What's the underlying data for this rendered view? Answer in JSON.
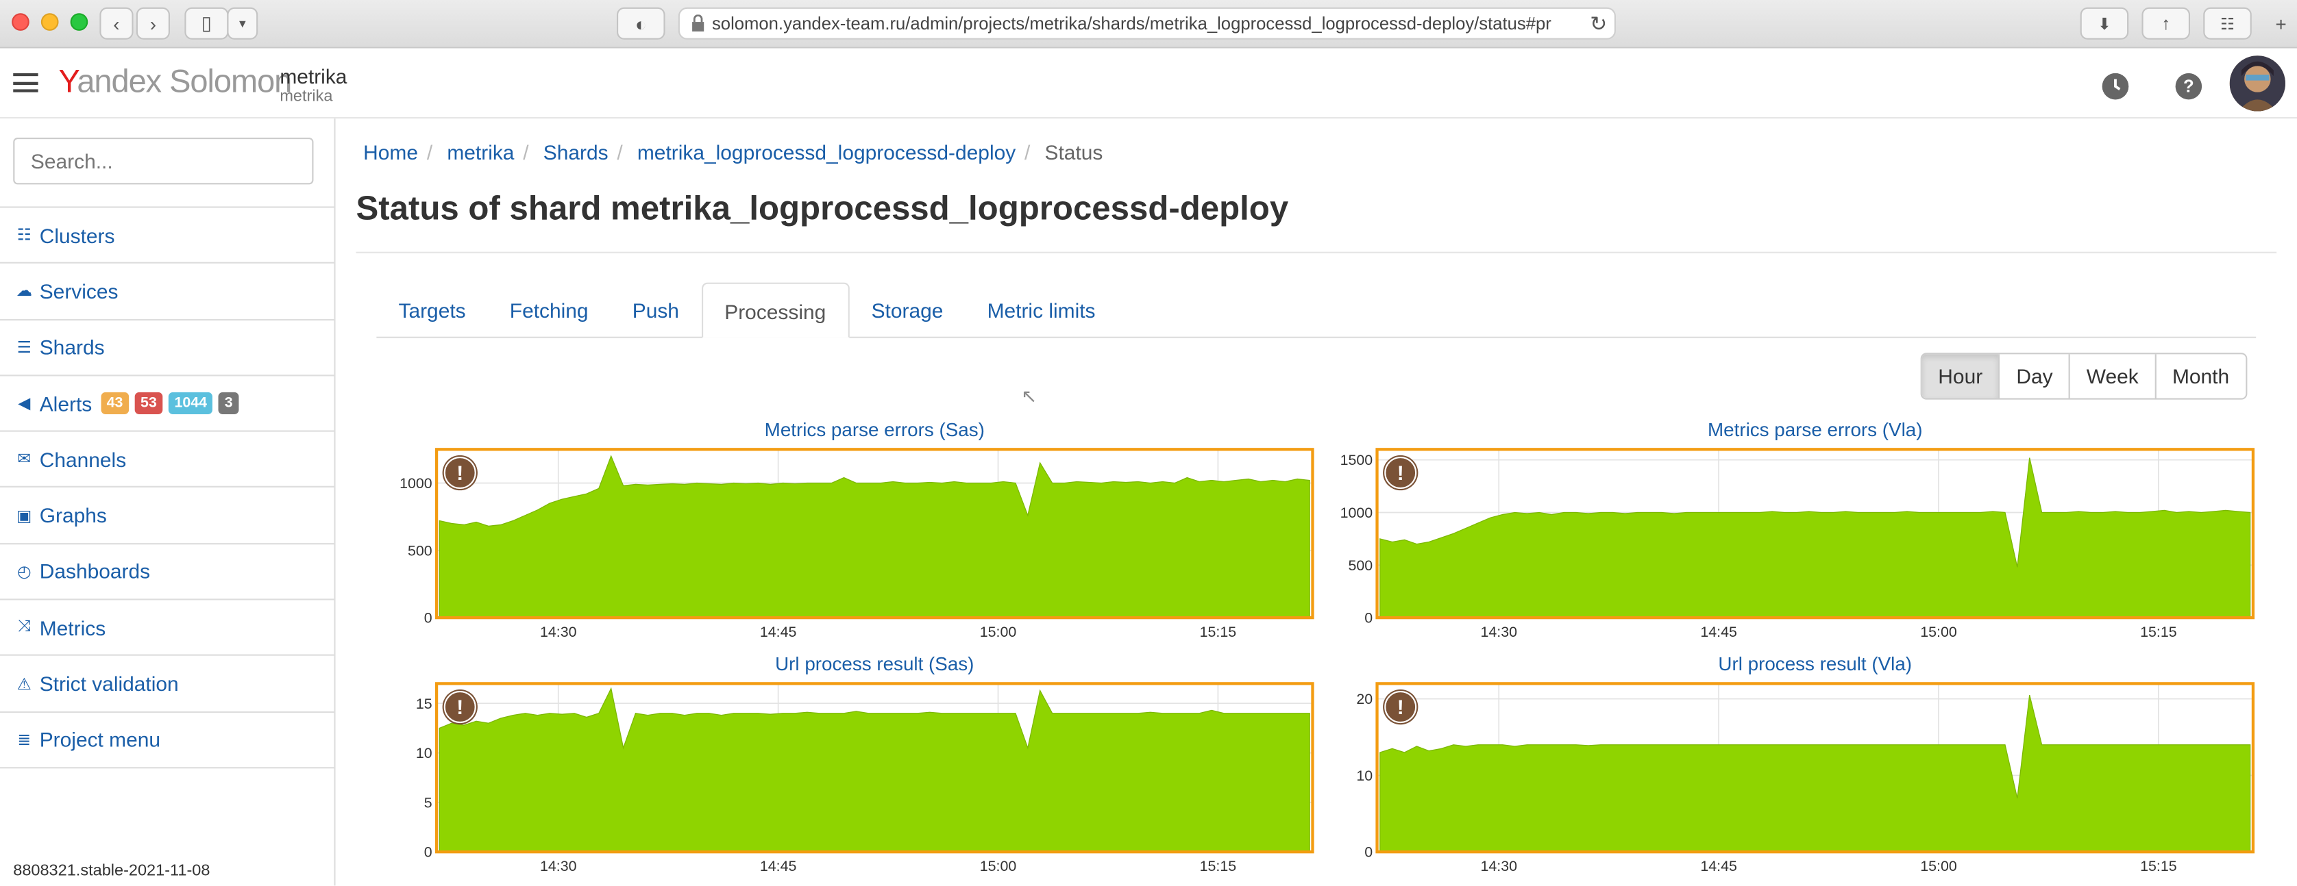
{
  "browser": {
    "url": "solomon.yandex-team.ru/admin/projects/metrika/shards/metrika_logprocessd_logprocessd-deploy/status#pr"
  },
  "header": {
    "logo": "Yandex Solomon",
    "logo_y": "Y",
    "logo_rest": "andex Solomon",
    "project": "metrika",
    "project_sub": "metrika"
  },
  "sidebar": {
    "search_placeholder": "Search...",
    "items": [
      {
        "label": "Clusters",
        "icon": "sitemap-icon"
      },
      {
        "label": "Services",
        "icon": "cloud-icon"
      },
      {
        "label": "Shards",
        "icon": "server-icon"
      },
      {
        "label": "Alerts",
        "icon": "bullhorn-icon"
      },
      {
        "label": "Channels",
        "icon": "envelope-icon"
      },
      {
        "label": "Graphs",
        "icon": "image-icon"
      },
      {
        "label": "Dashboards",
        "icon": "dashboard-icon"
      },
      {
        "label": "Metrics",
        "icon": "random-icon"
      },
      {
        "label": "Strict validation",
        "icon": "warning-icon"
      },
      {
        "label": "Project menu",
        "icon": "list-icon"
      }
    ],
    "alert_badges": [
      {
        "value": "43",
        "color": "#f0ad4e"
      },
      {
        "value": "53",
        "color": "#d9534f"
      },
      {
        "value": "1044",
        "color": "#5bc0de"
      },
      {
        "value": "3",
        "color": "#777777"
      }
    ],
    "version": "8808321.stable-2021-11-08"
  },
  "breadcrumbs": [
    "Home",
    "metrika",
    "Shards",
    "metrika_logprocessd_logprocessd-deploy",
    "Status"
  ],
  "page_title": "Status of shard metrika_logprocessd_logprocessd-deploy",
  "tabs": [
    "Targets",
    "Fetching",
    "Push",
    "Processing",
    "Storage",
    "Metric limits"
  ],
  "active_tab": "Processing",
  "time_range": [
    "Hour",
    "Day",
    "Week",
    "Month"
  ],
  "active_range": "Hour",
  "colors": {
    "link": "#1a5ea8",
    "area": "#8fd400",
    "alert_border": "#f39c12",
    "warn_icon": "#7a5236"
  },
  "chart_data": [
    {
      "type": "area",
      "title": "Metrics parse errors (Sas)",
      "x_ticks": [
        "14:30",
        "14:45",
        "15:00",
        "15:15"
      ],
      "y_ticks": [
        0,
        500,
        1000
      ],
      "ylim": [
        0,
        1250
      ],
      "series": [
        {
          "values": [
            720,
            700,
            690,
            710,
            680,
            690,
            720,
            760,
            800,
            850,
            880,
            900,
            920,
            960,
            1200,
            980,
            990,
            985,
            990,
            995,
            990,
            1000,
            995,
            990,
            1000,
            995,
            1000,
            990,
            1000,
            995,
            1000,
            1000,
            1000,
            1040,
            1000,
            1000,
            1000,
            1010,
            1000,
            1000,
            1005,
            1000,
            1010,
            1000,
            1000,
            1000,
            1010,
            1000,
            760,
            1150,
            1000,
            1000,
            1010,
            1005,
            1000,
            1010,
            1005,
            1010,
            1000,
            1010,
            1000,
            1040,
            1010,
            1020,
            1010,
            1020,
            1030,
            1010,
            1020,
            1010,
            1030,
            1020
          ]
        }
      ]
    },
    {
      "type": "area",
      "title": "Metrics parse errors (Vla)",
      "x_ticks": [
        "14:30",
        "14:45",
        "15:00",
        "15:15"
      ],
      "y_ticks": [
        0,
        500,
        1000,
        1500
      ],
      "ylim": [
        0,
        1600
      ],
      "series": [
        {
          "values": [
            750,
            720,
            740,
            700,
            720,
            760,
            800,
            850,
            900,
            950,
            980,
            1000,
            990,
            1000,
            980,
            1000,
            1000,
            990,
            1000,
            1000,
            990,
            1000,
            1000,
            1000,
            990,
            1000,
            1000,
            1000,
            1000,
            1000,
            1000,
            1000,
            1010,
            1000,
            1000,
            1010,
            1000,
            1000,
            1010,
            1000,
            1000,
            1000,
            1000,
            1010,
            1000,
            1000,
            1000,
            1000,
            1000,
            1000,
            1010,
            1000,
            480,
            1520,
            1000,
            1000,
            1000,
            1010,
            1000,
            1000,
            1010,
            1000,
            1000,
            1010,
            1020,
            1000,
            1010,
            1000,
            1010,
            1020,
            1010,
            1000
          ]
        }
      ]
    },
    {
      "type": "area",
      "title": "Url process result (Sas)",
      "x_ticks": [
        "14:30",
        "14:45",
        "15:00",
        "15:15"
      ],
      "y_ticks": [
        0,
        5,
        10,
        15
      ],
      "ylim": [
        0,
        17
      ],
      "series": [
        {
          "values": [
            12.5,
            13,
            12.8,
            13.2,
            13,
            13.5,
            13.8,
            14,
            13.8,
            14,
            13.9,
            14,
            13.6,
            14,
            16.5,
            10.5,
            14,
            13.8,
            14,
            14,
            13.8,
            14,
            14,
            13.8,
            14,
            14,
            14,
            13.9,
            14,
            14,
            14.1,
            14,
            14,
            14,
            14.2,
            14,
            14,
            14,
            14,
            14,
            14.1,
            14,
            14,
            14,
            14,
            14,
            14,
            14,
            10.5,
            16.3,
            14,
            14,
            14,
            14,
            14,
            14,
            14,
            14,
            14.1,
            14,
            14,
            14,
            14,
            14.3,
            14,
            14,
            14,
            14,
            14,
            14,
            14,
            14
          ]
        }
      ]
    },
    {
      "type": "area",
      "title": "Url process result (Vla)",
      "x_ticks": [
        "14:30",
        "14:45",
        "15:00",
        "15:15"
      ],
      "y_ticks": [
        0,
        10,
        20
      ],
      "ylim": [
        0,
        22
      ],
      "series": [
        {
          "values": [
            13,
            13.5,
            13,
            13.8,
            13.2,
            13.5,
            14,
            13.8,
            14,
            14,
            14,
            13.8,
            14,
            14,
            14,
            14,
            14,
            13.9,
            14,
            14,
            14,
            14,
            14,
            14,
            14,
            14,
            14,
            14,
            14,
            14,
            14,
            14,
            14,
            14,
            14,
            14,
            14,
            14,
            14,
            14,
            14,
            14,
            14,
            14,
            14,
            14,
            14,
            14,
            14,
            14,
            14,
            14,
            7,
            20.5,
            14,
            14,
            14,
            14,
            14,
            14,
            14,
            14,
            14,
            14,
            14,
            14,
            14,
            14,
            14,
            14,
            14,
            14
          ]
        }
      ]
    }
  ]
}
